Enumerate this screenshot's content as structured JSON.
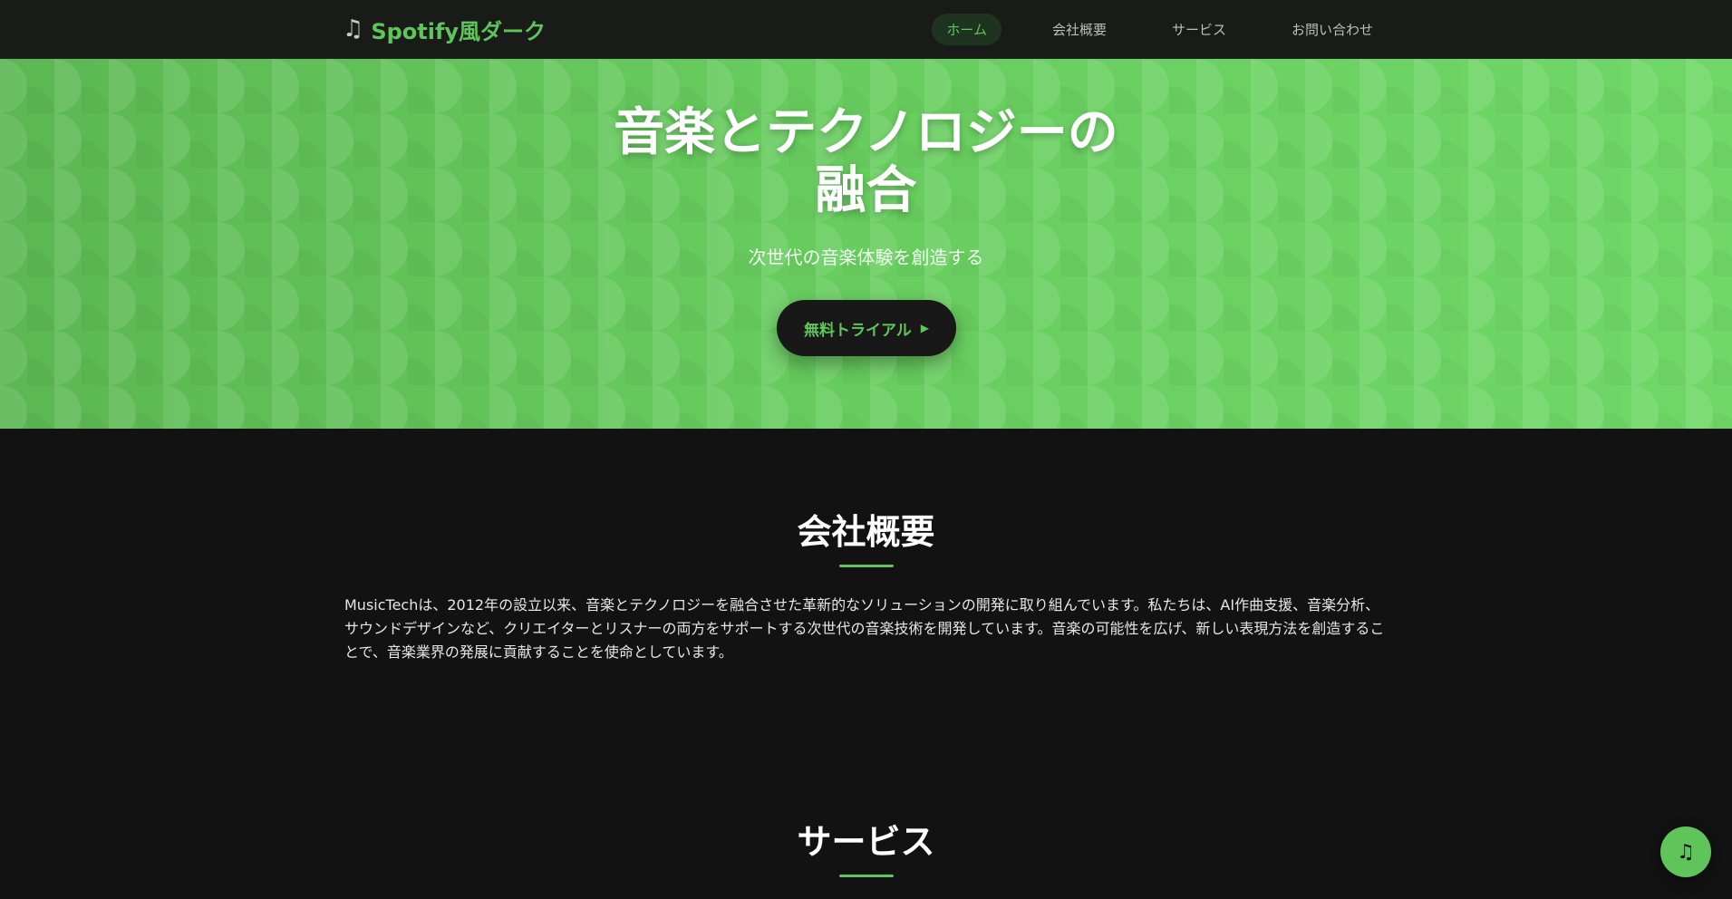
{
  "header": {
    "logo_icon": "♫",
    "logo_text": "Spotify風ダーク",
    "nav": [
      {
        "label": "ホーム",
        "active": true
      },
      {
        "label": "会社概要",
        "active": false
      },
      {
        "label": "サービス",
        "active": false
      },
      {
        "label": "お問い合わせ",
        "active": false
      }
    ]
  },
  "hero": {
    "title_line1": "音楽とテクノロジーの",
    "title_line2": "融合",
    "subtitle": "次世代の音楽体験を創造する",
    "cta_label": "無料トライアル",
    "cta_icon": "▶"
  },
  "about": {
    "title": "会社概要",
    "text": "MusicTechは、2012年の設立以来、音楽とテクノロジーを融合させた革新的なソリューションの開発に取り組んでいます。私たちは、AI作曲支援、音楽分析、サウンドデザインなど、クリエイターとリスナーの両方をサポートする次世代の音楽技術を開発しています。音楽の可能性を広げ、新しい表現方法を創造することで、音楽業界の発展に貢献することを使命としています。"
  },
  "services": {
    "title": "サービス"
  },
  "fab": {
    "icon": "♫"
  },
  "colors": {
    "accent": "#5fc45a",
    "background": "#121212",
    "header": "#181b18"
  }
}
